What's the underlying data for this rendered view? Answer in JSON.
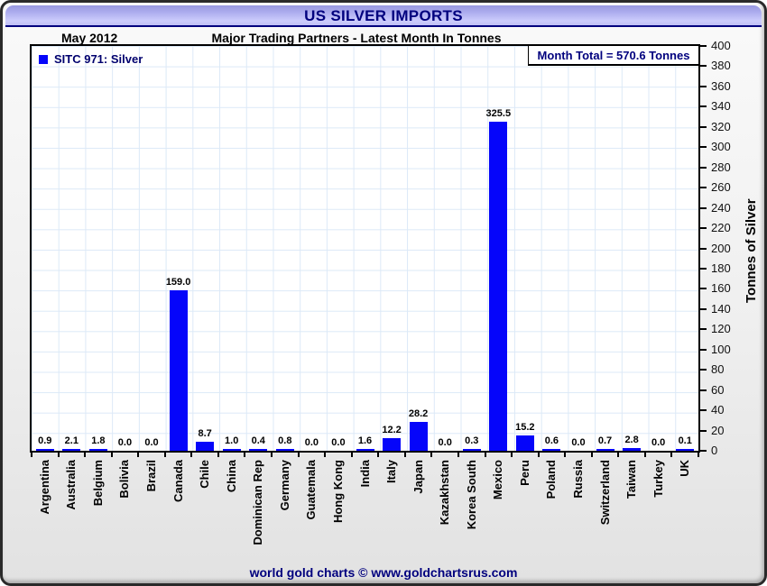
{
  "header": {
    "title": "US SILVER IMPORTS"
  },
  "subtitle_row": {
    "date": "May 2012",
    "text": "Major Trading Partners - Latest Month In Tonnes"
  },
  "legend": {
    "series_label": "SITC 971: Silver"
  },
  "annotation": {
    "month_total": "Month Total = 570.6 Tonnes"
  },
  "footer": {
    "credit": "world gold charts © www.goldchartsrus.com"
  },
  "colors": {
    "bar": "#0505fa",
    "navy_text": "#00007e",
    "grid": "#dce9f7",
    "header_band_top": "#9898e0",
    "header_band_bottom": "#ccccfc"
  },
  "chart_data": {
    "type": "bar",
    "title": "US SILVER IMPORTS",
    "subtitle": "Major Trading Partners - Latest Month In Tonnes",
    "period": "May 2012",
    "series_name": "SITC 971: Silver",
    "month_total_tonnes": 570.6,
    "categories": [
      "Argentina",
      "Australia",
      "Belgium",
      "Bolivia",
      "Brazil",
      "Canada",
      "Chile",
      "China",
      "Dominican Rep",
      "Germany",
      "Guatemala",
      "Hong Kong",
      "India",
      "Italy",
      "Japan",
      "Kazakhstan",
      "Korea South",
      "Mexico",
      "Peru",
      "Poland",
      "Russia",
      "Switzerland",
      "Taiwan",
      "Turkey",
      "UK"
    ],
    "values": [
      0.9,
      2.1,
      1.8,
      0.0,
      0.0,
      159.0,
      8.7,
      1.0,
      0.4,
      0.8,
      0.0,
      0.0,
      1.6,
      12.2,
      28.2,
      0.0,
      0.3,
      325.5,
      15.2,
      0.6,
      0.0,
      0.7,
      2.8,
      0.0,
      0.1
    ],
    "xlabel": "",
    "ylabel": "Tonnes of Silver",
    "ylim": [
      0,
      400
    ],
    "ytick_interval": 20,
    "grid": true,
    "legend_position": "top-left",
    "value_labels": true
  }
}
